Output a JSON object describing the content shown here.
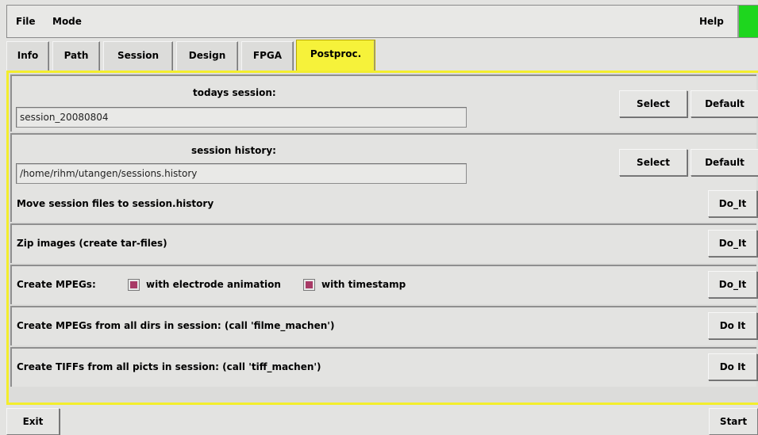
{
  "menubar": {
    "file": "File",
    "mode": "Mode",
    "help": "Help",
    "status_color": "#1ed61e"
  },
  "tabs": [
    {
      "label": "Info"
    },
    {
      "label": "Path"
    },
    {
      "label": "Session"
    },
    {
      "label": "Design"
    },
    {
      "label": "FPGA"
    },
    {
      "label": "Postproc."
    }
  ],
  "active_tab": "Postproc.",
  "todays_session": {
    "label": "todays session:",
    "value": "session_20080804",
    "select": "Select",
    "default": "Default"
  },
  "session_history": {
    "label": "session history:",
    "value": "/home/rihm/utangen/sessions.history",
    "select": "Select",
    "default": "Default"
  },
  "actions": [
    {
      "label": "Move session files to session.history",
      "button": "Do_It"
    },
    {
      "label": "Zip images (create tar-files)",
      "button": "Do_It"
    },
    {
      "label": "Create MPEGs:",
      "button": "Do_It"
    },
    {
      "label": "Create MPEGs from all dirs in session: (call 'filme_machen')",
      "button": "Do It"
    },
    {
      "label": "Create TIFFs from all picts in session: (call 'tiff_machen')",
      "button": "Do It"
    }
  ],
  "mpeg_options": {
    "electrode": {
      "label": "with electrode animation",
      "checked": true
    },
    "timestamp": {
      "label": "with timestamp",
      "checked": true
    }
  },
  "bottom": {
    "exit": "Exit",
    "start": "Start"
  },
  "colors": {
    "active_tab": "#f6f23a",
    "frame": "#f3ee2c",
    "checkbox": "#a83a66"
  }
}
